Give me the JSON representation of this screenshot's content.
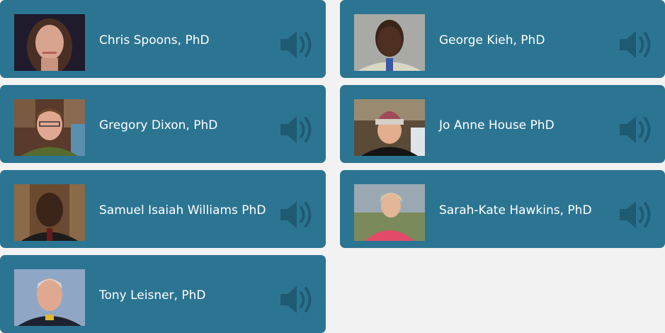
{
  "accent_color": "#2c7592",
  "speaker_icon": "speaker-volume-icon",
  "people": [
    {
      "id": "chris-spoons",
      "name": "Chris Spoons, PhD"
    },
    {
      "id": "george-kieh",
      "name": "George Kieh, PhD"
    },
    {
      "id": "gregory-dixon",
      "name": "Gregory Dixon, PhD"
    },
    {
      "id": "jo-anne-house",
      "name": "Jo Anne House PhD"
    },
    {
      "id": "samuel-williams",
      "name": "Samuel Isaiah Williams PhD"
    },
    {
      "id": "sarah-kate-hawkins",
      "name": "Sarah-Kate Hawkins, PhD"
    },
    {
      "id": "tony-leisner",
      "name": "Tony Leisner, PhD"
    }
  ]
}
